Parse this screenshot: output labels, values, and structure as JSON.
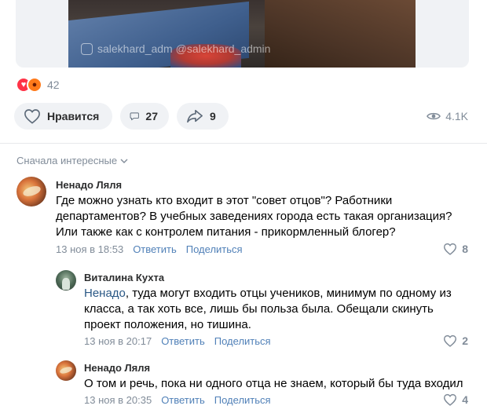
{
  "post": {
    "watermark": "salekhard_adm  @salekhard_admin",
    "reactions_count": "42",
    "like_label": "Нравится",
    "comments_count": "27",
    "shares_count": "9",
    "views_count": "4.1K"
  },
  "comments_sort": {
    "label": "Сначала интересные"
  },
  "comments": [
    {
      "author": "Ненадо Ляля",
      "text": "Где можно узнать кто входит в этот \"совет отцов\"? Работники департаментов? В учебных заведениях города есть такая организация? Или также как с контролем питания - прикормленный блогер?",
      "date": "13 ноя в 18:53",
      "reply_label": "Ответить",
      "share_label": "Поделиться",
      "likes": "8"
    },
    {
      "author": "Виталина Кухта",
      "mention": "Ненадо",
      "text": ", туда могут входить отцы учеников, минимум по одному из класса, а так хоть все, лишь бы польза была. Обещали скинуть проект положения, но тишина.",
      "date": "13 ноя в 20:17",
      "reply_label": "Ответить",
      "share_label": "Поделиться",
      "likes": "2"
    },
    {
      "author": "Ненадо Ляля",
      "text": "О том и речь, пока ни одного отца не знаем, который бы туда входил",
      "date": "13 ноя в 20:35",
      "reply_label": "Ответить",
      "share_label": "Поделиться",
      "likes": "4"
    }
  ]
}
